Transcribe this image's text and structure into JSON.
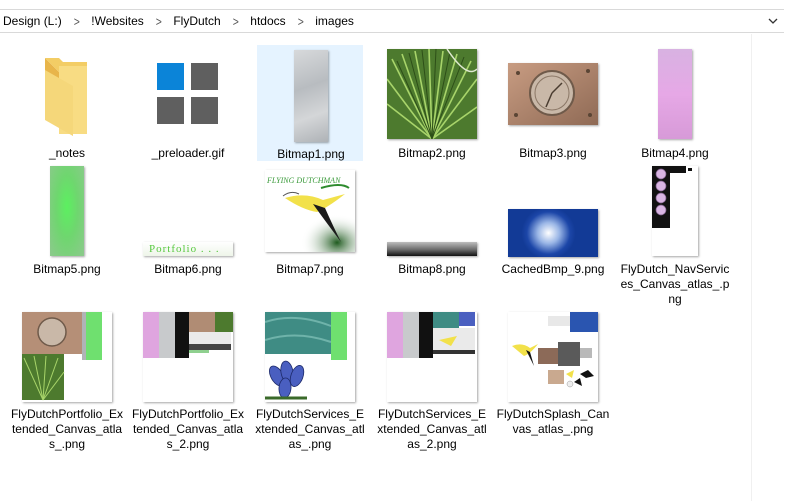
{
  "address_bar": {
    "crumbs": [
      "Design (L:)",
      "!Websites",
      "FlyDutch",
      "htdocs",
      "images"
    ]
  },
  "files": [
    {
      "name": "_notes",
      "type": "folder"
    },
    {
      "name": "_preloader.gif",
      "type": "image"
    },
    {
      "name": "Bitmap1.png",
      "type": "image",
      "selected": true
    },
    {
      "name": "Bitmap2.png",
      "type": "image"
    },
    {
      "name": "Bitmap3.png",
      "type": "image"
    },
    {
      "name": "Bitmap4.png",
      "type": "image"
    },
    {
      "name": "Bitmap5.png",
      "type": "image"
    },
    {
      "name": "Bitmap6.png",
      "type": "image"
    },
    {
      "name": "Bitmap7.png",
      "type": "image"
    },
    {
      "name": "Bitmap8.png",
      "type": "image"
    },
    {
      "name": "CachedBmp_9.png",
      "type": "image"
    },
    {
      "name": "FlyDutch_NavServices_Canvas_atlas_.png",
      "type": "image"
    },
    {
      "name": "FlyDutchPortfolio_Extended_Canvas_atlas_.png",
      "type": "image"
    },
    {
      "name": "FlyDutchPortfolio_Extended_Canvas_atlas_2.png",
      "type": "image"
    },
    {
      "name": "FlyDutchServices_Extended_Canvas_atlas_.png",
      "type": "image"
    },
    {
      "name": "FlyDutchServices_Extended_Canvas_atlas_2.png",
      "type": "image"
    },
    {
      "name": "FlyDutchSplash_Canvas_atlas_.png",
      "type": "image"
    }
  ],
  "thumb_texts": {
    "bitmap6": "Portfolio . . .",
    "bitmap7": "FLYING DUTCHMAN"
  },
  "colors": {
    "selection": "#e5f3ff",
    "folder": "#f5d77a",
    "preloader_blue": "#0b84d8",
    "preloader_gray": "#5f5f5f"
  }
}
